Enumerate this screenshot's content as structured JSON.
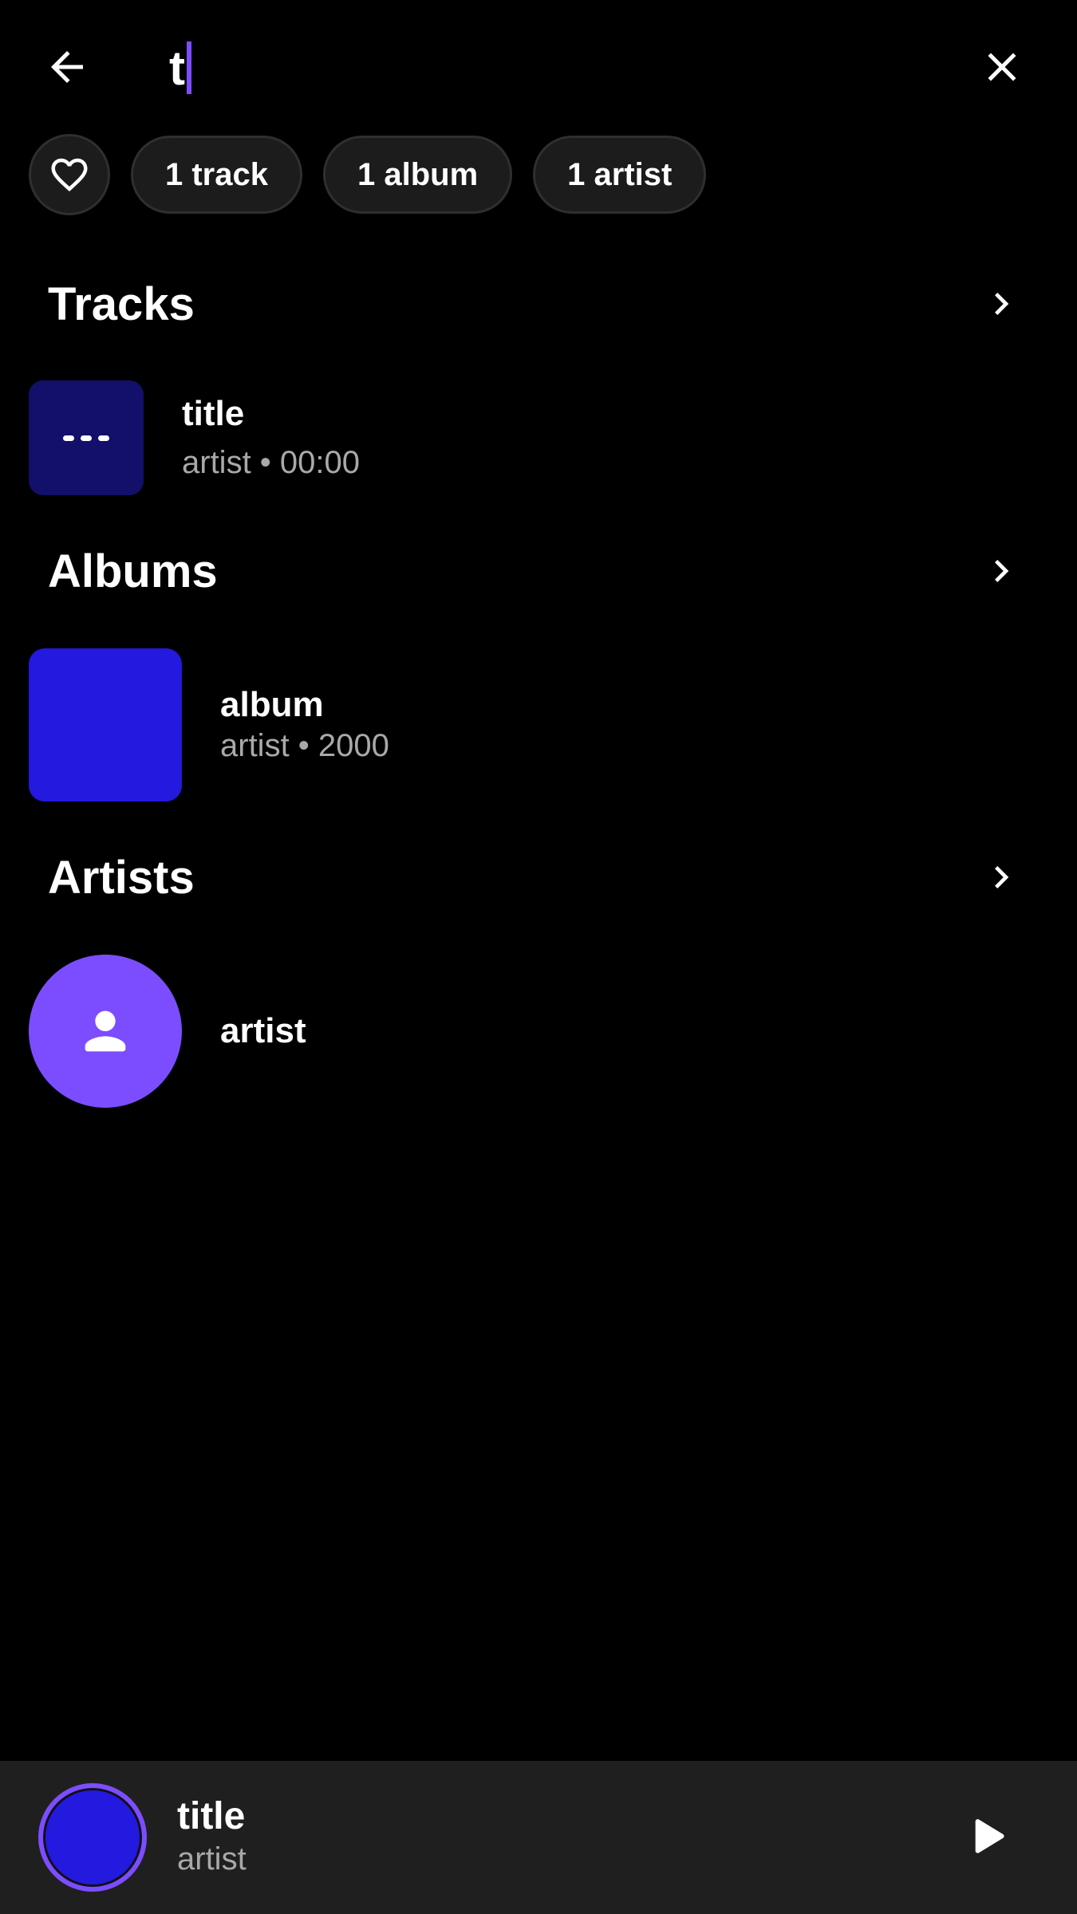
{
  "search": {
    "query": "t",
    "back_icon": "arrow-back-icon",
    "clear_icon": "close-icon"
  },
  "filters": {
    "favorites_icon": "heart-outline-icon",
    "chips": [
      {
        "label": "1 track"
      },
      {
        "label": "1 album"
      },
      {
        "label": "1 artist"
      }
    ]
  },
  "sections": {
    "tracks": {
      "title": "Tracks",
      "items": [
        {
          "title": "title",
          "subtitle": "artist • 00:00",
          "art_icon": "more-horiz-icon"
        }
      ]
    },
    "albums": {
      "title": "Albums",
      "items": [
        {
          "title": "album",
          "subtitle": "artist • 2000"
        }
      ]
    },
    "artists": {
      "title": "Artists",
      "items": [
        {
          "name": "artist",
          "art_icon": "person-icon"
        }
      ]
    }
  },
  "mini_player": {
    "title": "title",
    "artist": "artist",
    "play_icon": "play-icon"
  },
  "colors": {
    "background": "#000000",
    "accent": "#7c4dff",
    "track_art": "#12106a",
    "album_art": "#2419de",
    "chip_bg": "#1c1c1c",
    "player_bg": "#1f1f1f",
    "secondary_text": "#a9a9a9"
  }
}
